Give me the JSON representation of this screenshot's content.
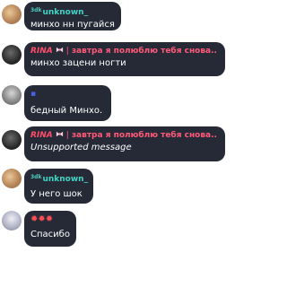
{
  "messages": [
    {
      "prefix": "3dk",
      "name": "unknown_",
      "text": "минхо нн пугайся"
    },
    {
      "name": "RINA",
      "status": "завтра я полюблю тебя снова..",
      "text": "минхо зацени ногти"
    },
    {
      "name": "▪",
      "text": "бедный Минхо."
    },
    {
      "name": "RINA",
      "status": "завтра я полюблю тебя снова..",
      "text": "Unsupported message"
    },
    {
      "prefix": "3dk",
      "name": "unknown_",
      "text": "У него шок"
    },
    {
      "name": "✹✹✹",
      "text": "Спасибо"
    }
  ],
  "colors": {
    "bubble": "#262a36",
    "cyan_name": "#3fd4c4",
    "rina_name": "#ff4d6b",
    "stars": "#ff4d55"
  }
}
